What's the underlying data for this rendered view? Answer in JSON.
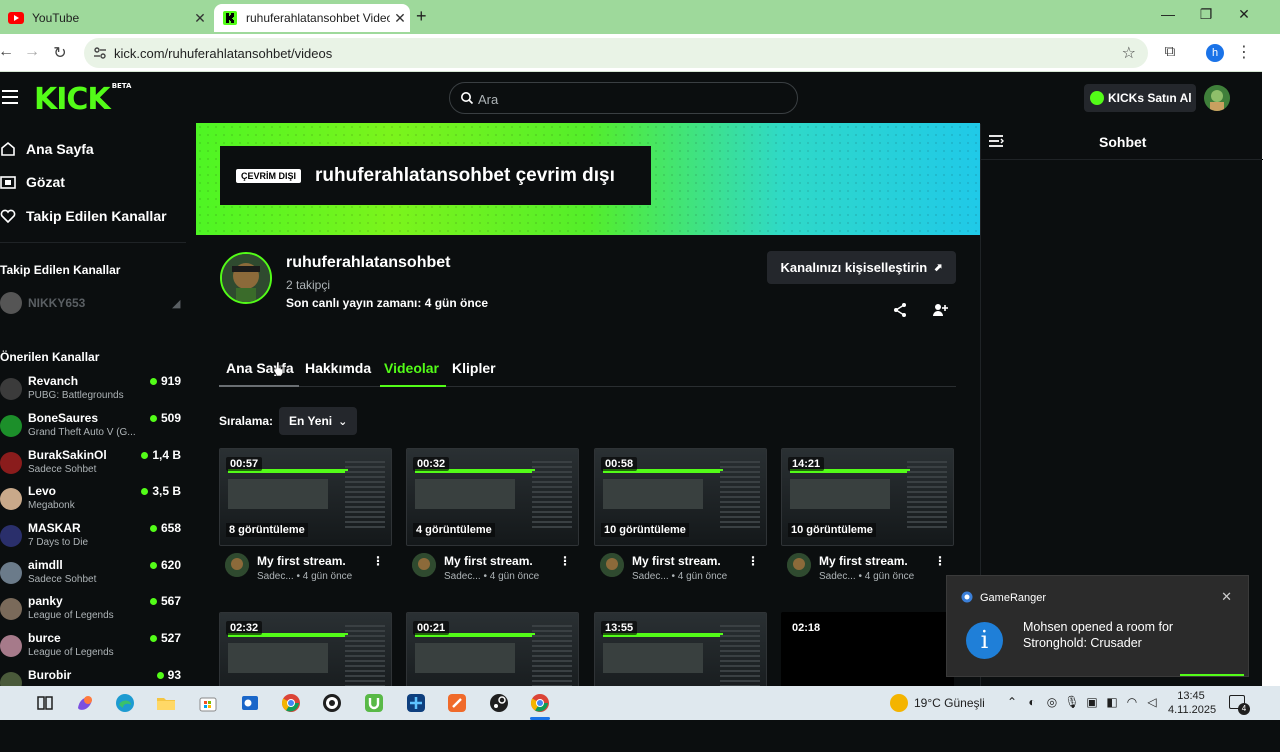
{
  "browser": {
    "tabs": [
      {
        "label": "YouTube",
        "active": false
      },
      {
        "label": "ruhuferahlatansohbet Videos - ",
        "active": true
      }
    ],
    "url": "kick.com/ruhuferahlatansohbet/videos",
    "profile_initial": "h",
    "colors": {
      "tabbar": "#9ed99b",
      "accent": "#53fc18"
    }
  },
  "kick": {
    "logo": "KICK",
    "logo_badge": "BETA",
    "search_placeholder": "Ara",
    "buy_kicks": "KICKs Satın Al"
  },
  "sidebar": {
    "nav": [
      {
        "label": "Ana Sayfa",
        "icon": "home-icon"
      },
      {
        "label": "Gözat",
        "icon": "browse-icon"
      },
      {
        "label": "Takip Edilen Kanallar",
        "icon": "heart-icon"
      }
    ],
    "followed_heading": "Takip Edilen Kanallar",
    "followed": [
      {
        "name": "NIKKY653"
      }
    ],
    "recommended_heading": "Önerilen Kanallar",
    "recommended": [
      {
        "name": "Revanch",
        "category": "PUBG: Battlegrounds",
        "viewers": "919",
        "color": "#3b3b3b"
      },
      {
        "name": "BoneSaures",
        "category": "Grand Theft Auto V (G...",
        "viewers": "509",
        "color": "#1c8f2a"
      },
      {
        "name": "BurakSakinOl",
        "category": "Sadece Sohbet",
        "viewers": "1,4 B",
        "color": "#8a1c1c"
      },
      {
        "name": "Levo",
        "category": "Megabonk",
        "viewers": "3,5 B",
        "color": "#c9a98a"
      },
      {
        "name": "MASKAR",
        "category": "7 Days to Die",
        "viewers": "658",
        "color": "#2a2f6b"
      },
      {
        "name": "aimdll",
        "category": "Sadece Sohbet",
        "viewers": "620",
        "color": "#6b7b8a"
      },
      {
        "name": "panky",
        "category": "League of Legends",
        "viewers": "567",
        "color": "#7a6a5a"
      },
      {
        "name": "burce",
        "category": "League of Legends",
        "viewers": "527",
        "color": "#a67a8a"
      },
      {
        "name": "Burobir",
        "category": "",
        "viewers": "93",
        "color": "#4a5a3a"
      }
    ]
  },
  "channel": {
    "offline_badge": "ÇEVRİM DIŞI",
    "offline_title": "ruhuferahlatansohbet çevrim dışı",
    "name": "ruhuferahlatansohbet",
    "followers": "2 takipçi",
    "last_live": "Son canlı yayın zamanı: 4 gün önce",
    "customize": "Kanalınızı kişiselleştirin",
    "tabs": [
      "Ana Sayfa",
      "Hakkımda",
      "Videolar",
      "Klipler"
    ],
    "active_tab": "Videolar",
    "sort_label": "Sıralama:",
    "sort_value": "En Yeni"
  },
  "videos": [
    {
      "duration": "00:57",
      "views": "8 görüntüleme",
      "title": "My first stream.",
      "meta": "Sadec... • 4 gün önce"
    },
    {
      "duration": "00:32",
      "views": "4 görüntüleme",
      "title": "My first stream.",
      "meta": "Sadec... • 4 gün önce"
    },
    {
      "duration": "00:58",
      "views": "10 görüntüleme",
      "title": "My first stream.",
      "meta": "Sadec... • 4 gün önce"
    },
    {
      "duration": "14:21",
      "views": "10 görüntüleme",
      "title": "My first stream.",
      "meta": "Sadec... • 4 gün önce"
    },
    {
      "duration": "02:32",
      "views": "",
      "title": "",
      "meta": ""
    },
    {
      "duration": "00:21",
      "views": "",
      "title": "",
      "meta": ""
    },
    {
      "duration": "13:55",
      "views": "",
      "title": "",
      "meta": ""
    },
    {
      "duration": "02:18",
      "views": "",
      "title": "",
      "meta": ""
    }
  ],
  "chat": {
    "title": "Sohbet"
  },
  "toast": {
    "app": "GameRanger",
    "message": "Mohsen opened a room for Stronghold: Crusader"
  },
  "taskbar": {
    "weather": "19°C  Güneşli",
    "time": "13:45",
    "date": "4.11.2025",
    "notifications": "4"
  }
}
